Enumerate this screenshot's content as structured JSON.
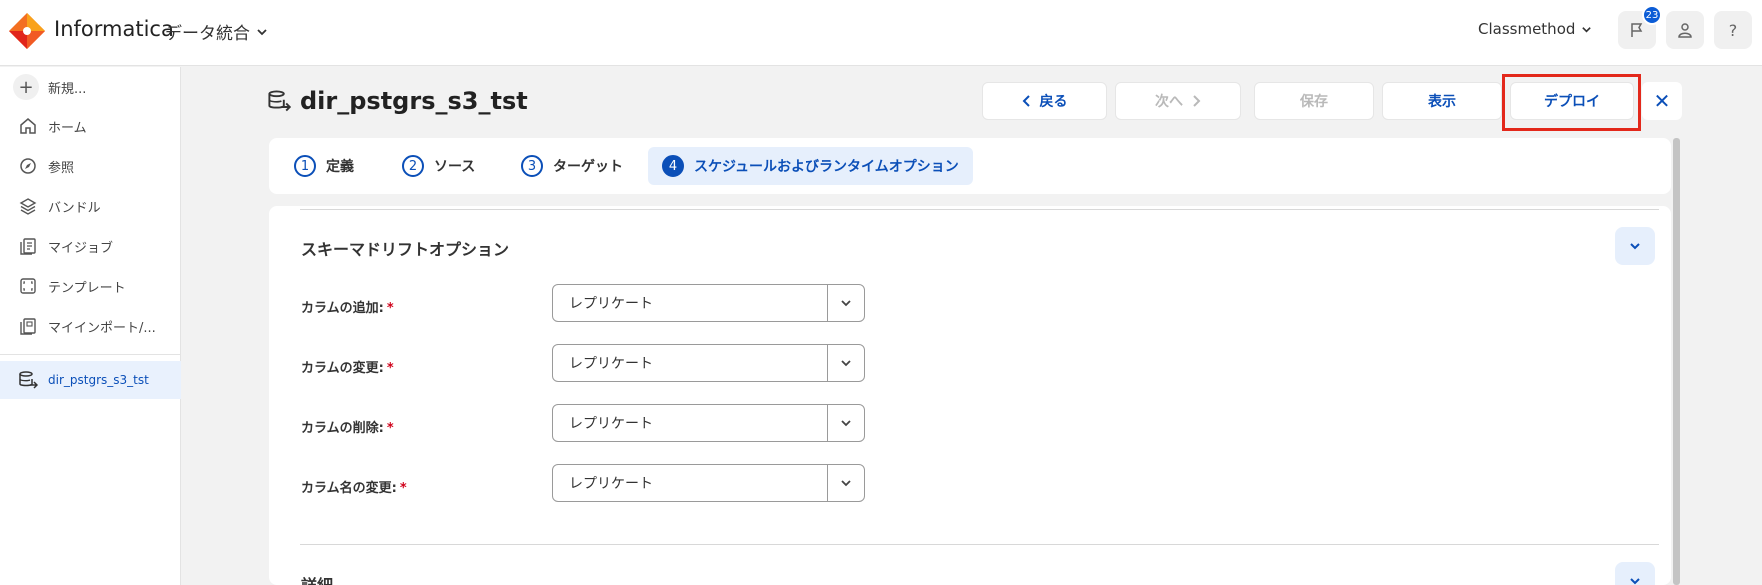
{
  "header": {
    "brand": "Informatica",
    "product": "データ統合",
    "org": "Classmethod",
    "notification_count": "23",
    "icons": [
      "flag-icon",
      "user-icon",
      "help-icon"
    ],
    "help_glyph": "?"
  },
  "sidebar": {
    "new_label": "新規...",
    "items": [
      {
        "label": "ホーム",
        "icon": "home-icon"
      },
      {
        "label": "参照",
        "icon": "compass-icon"
      },
      {
        "label": "バンドル",
        "icon": "layers-icon"
      },
      {
        "label": "マイジョブ",
        "icon": "jobs-icon"
      },
      {
        "label": "テンプレート",
        "icon": "template-icon"
      },
      {
        "label": "マイインポート/...",
        "icon": "import-icon"
      }
    ],
    "active_item": {
      "label": "dir_pstgrs_s3_tst",
      "icon": "database-transfer-icon"
    }
  },
  "page": {
    "title": "dir_pstgrs_s3_tst",
    "buttons": {
      "back": "戻る",
      "next": "次へ",
      "save": "保存",
      "view": "表示",
      "deploy": "デプロイ",
      "close": "✕"
    }
  },
  "steps": [
    {
      "num": "1",
      "label": "定義"
    },
    {
      "num": "2",
      "label": "ソース"
    },
    {
      "num": "3",
      "label": "ターゲット"
    },
    {
      "num": "4",
      "label": "スケジュールおよびランタイムオプション"
    }
  ],
  "schema_drift": {
    "title": "スキーマドリフトオプション",
    "fields": [
      {
        "label": "カラムの追加:",
        "value": "レプリケート"
      },
      {
        "label": "カラムの変更:",
        "value": "レプリケート"
      },
      {
        "label": "カラムの削除:",
        "value": "レプリケート"
      },
      {
        "label": "カラム名の変更:",
        "value": "レプリケート"
      }
    ],
    "required_mark": "*"
  },
  "details": {
    "title": "詳細"
  },
  "colors": {
    "accent": "#0b4fb8",
    "highlight_frame": "#e3281b",
    "required": "#d0021b"
  }
}
